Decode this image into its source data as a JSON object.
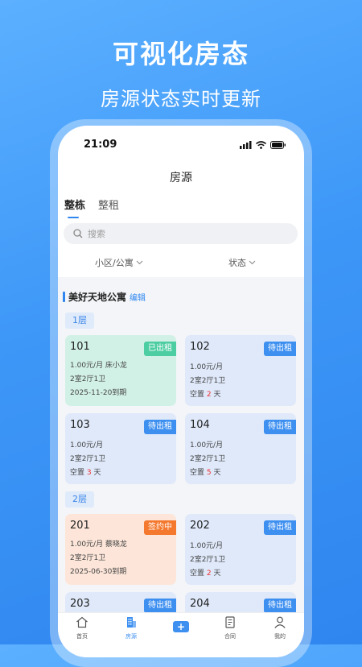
{
  "promo": {
    "title": "可视化房态",
    "subtitle": "房源状态实时更新"
  },
  "status_bar": {
    "time": "21:09"
  },
  "nav": {
    "title": "房源"
  },
  "tabs": [
    {
      "label": "整栋",
      "active": true
    },
    {
      "label": "整租",
      "active": false
    }
  ],
  "search": {
    "placeholder": "搜索"
  },
  "filters": {
    "community": "小区/公寓",
    "status": "状态"
  },
  "building": {
    "name": "美好天地公寓",
    "edit": "编辑"
  },
  "floors": [
    "1层",
    "2层"
  ],
  "rooms": [
    {
      "room": "101",
      "badge": "已出租",
      "line1": "1.00元/月  床小龙",
      "line2": "2室2厅1卫",
      "line3": "2025-11-20到期"
    },
    {
      "room": "102",
      "badge": "待出租",
      "line1": "1.00元/月",
      "line2": "2室2厅1卫",
      "vacant_pre": "空置 ",
      "vacant_days": "2",
      "vacant_post": " 天"
    },
    {
      "room": "103",
      "badge": "待出租",
      "line1": "1.00元/月",
      "line2": "2室2厅1卫",
      "vacant_pre": "空置 ",
      "vacant_days": "3",
      "vacant_post": " 天"
    },
    {
      "room": "104",
      "badge": "待出租",
      "line1": "1.00元/月",
      "line2": "2室2厅1卫",
      "vacant_pre": "空置 ",
      "vacant_days": "5",
      "vacant_post": " 天"
    },
    {
      "room": "201",
      "badge": "签约中",
      "line1": "1.00元/月  蔡晓龙",
      "line2": "2室2厅1卫",
      "line3": "2025-06-30到期"
    },
    {
      "room": "202",
      "badge": "待出租",
      "line1": "1.00元/月",
      "line2": "2室2厅1卫",
      "vacant_pre": "空置 ",
      "vacant_days": "2",
      "vacant_post": " 天"
    },
    {
      "room": "203",
      "badge": "待出租"
    },
    {
      "room": "204",
      "badge": "待出租"
    }
  ],
  "bottom_nav": [
    {
      "label": "首页",
      "icon": "home-icon"
    },
    {
      "label": "房源",
      "icon": "building-icon",
      "active": true
    },
    {
      "label": "",
      "icon": "plus-icon"
    },
    {
      "label": "合同",
      "icon": "contract-icon"
    },
    {
      "label": "我的",
      "icon": "user-icon"
    }
  ],
  "colors": {
    "accent": "#2f86ef",
    "rented": "#4ccda2",
    "vacant": "#3d8ff0",
    "signing": "#f4782d"
  }
}
